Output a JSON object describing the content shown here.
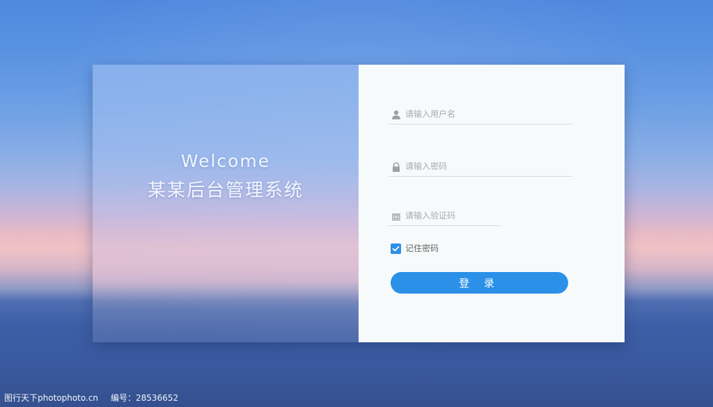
{
  "welcome": {
    "title": "Welcome",
    "system_name": "某某后台管理系统"
  },
  "form": {
    "username": {
      "placeholder": "请输入用户名",
      "icon": "user-icon"
    },
    "password": {
      "placeholder": "请输入密码",
      "icon": "lock-icon"
    },
    "captcha": {
      "placeholder": "请输入验证码",
      "icon": "captcha-icon"
    },
    "remember": {
      "label": "记住密码",
      "checked": true
    },
    "login_label": "登 录"
  },
  "watermark": {
    "site": "图行天下photophoto.cn",
    "code_label": "编号：28536652"
  },
  "colors": {
    "accent": "#2b90e8",
    "panel_bg": "#f7fafa",
    "placeholder": "#a7abb0"
  }
}
